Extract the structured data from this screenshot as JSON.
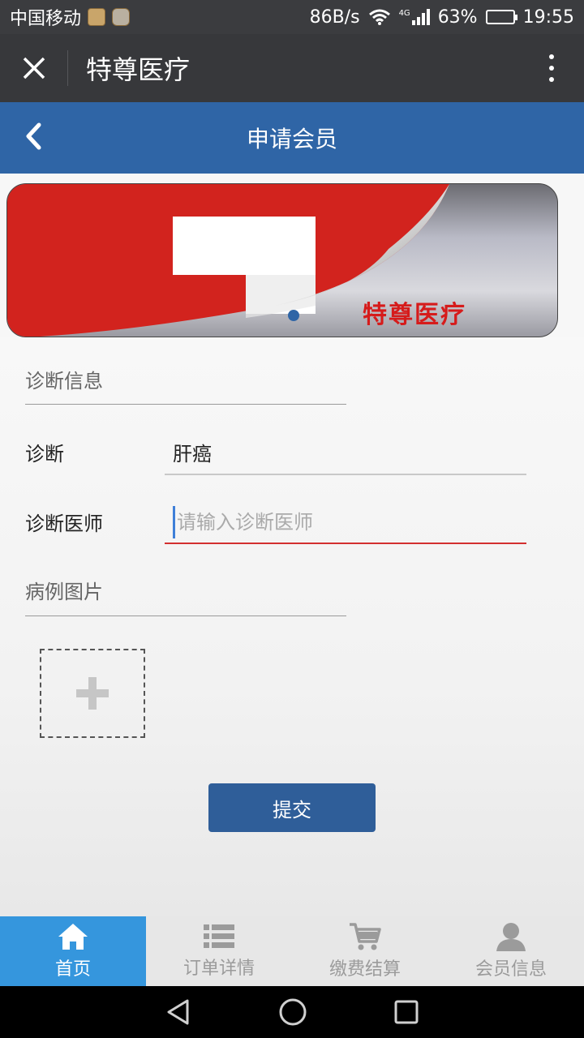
{
  "status_bar": {
    "carrier": "中国移动",
    "net_speed": "86B/s",
    "network_type": "4G",
    "battery": "63%",
    "battery_level": 0.63,
    "time": "19:55"
  },
  "title_bar": {
    "title": "特尊医疗",
    "close_icon": "close-icon",
    "more_icon": "more-vertical-icon"
  },
  "page_header": {
    "title": "申请会员",
    "back_icon": "chevron-left-icon"
  },
  "banner": {
    "text": "特尊医疗"
  },
  "form": {
    "diagnosis_section_label": "诊断信息",
    "diagnosis_label": "诊断",
    "diagnosis_value": "肝癌",
    "doctor_label": "诊断医师",
    "doctor_placeholder": "请输入诊断医师",
    "doctor_value": "",
    "case_images_label": "病例图片",
    "submit_label": "提交"
  },
  "tab_bar": {
    "items": [
      {
        "label": "首页",
        "icon": "home-icon",
        "active": true
      },
      {
        "label": "订单详情",
        "icon": "list-icon",
        "active": false
      },
      {
        "label": "缴费结算",
        "icon": "cart-icon",
        "active": false
      },
      {
        "label": "会员信息",
        "icon": "user-icon",
        "active": false
      }
    ]
  },
  "colors": {
    "header_blue": "#2f65a6",
    "tab_active": "#3596dd",
    "input_active_underline": "#d32f2f",
    "brand_red": "#d61b1b"
  }
}
